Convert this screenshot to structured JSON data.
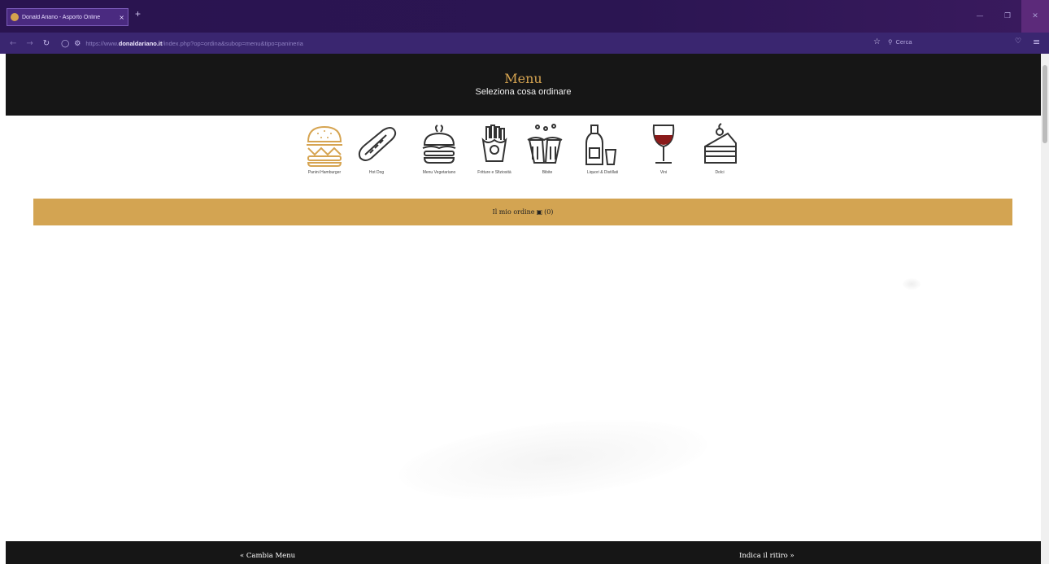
{
  "browser": {
    "tab_title": "Donald Ariano - Asporto Online",
    "tab_close": "×",
    "new_tab": "+",
    "url_prefix": "https://www.",
    "url_domain": "donaldariano.it",
    "url_path": "/index.php?op=ordina&subop=menu&tipo=panineria",
    "search_placeholder": "Cerca"
  },
  "header": {
    "title": "Menu",
    "subtitle": "Seleziona cosa ordinare"
  },
  "categories": [
    {
      "label": "Panini Hamburger",
      "icon": "burger-icon",
      "active": true
    },
    {
      "label": "Hot Dog",
      "icon": "hotdog-icon",
      "active": false
    },
    {
      "label": "Menu Vegetariano",
      "icon": "veggie-burger-icon",
      "active": false
    },
    {
      "label": "Fritture e Sfiziosità",
      "icon": "fries-icon",
      "active": false
    },
    {
      "label": "Bibite",
      "icon": "beer-mugs-icon",
      "active": false
    },
    {
      "label": "Liquori & Distillati",
      "icon": "bottle-glass-icon",
      "active": false
    },
    {
      "label": "Vini",
      "icon": "wine-glass-icon",
      "active": false
    },
    {
      "label": "Dolci",
      "icon": "cake-slice-icon",
      "active": false
    }
  ],
  "order_bar": {
    "label": "Il mio ordine",
    "count": "(0)"
  },
  "footer": {
    "left": "« Cambia Menu",
    "right": "Indica il ritiro »"
  },
  "colors": {
    "accent": "#d3a452",
    "dark": "#161616",
    "browser_bg": "#2a1450"
  }
}
